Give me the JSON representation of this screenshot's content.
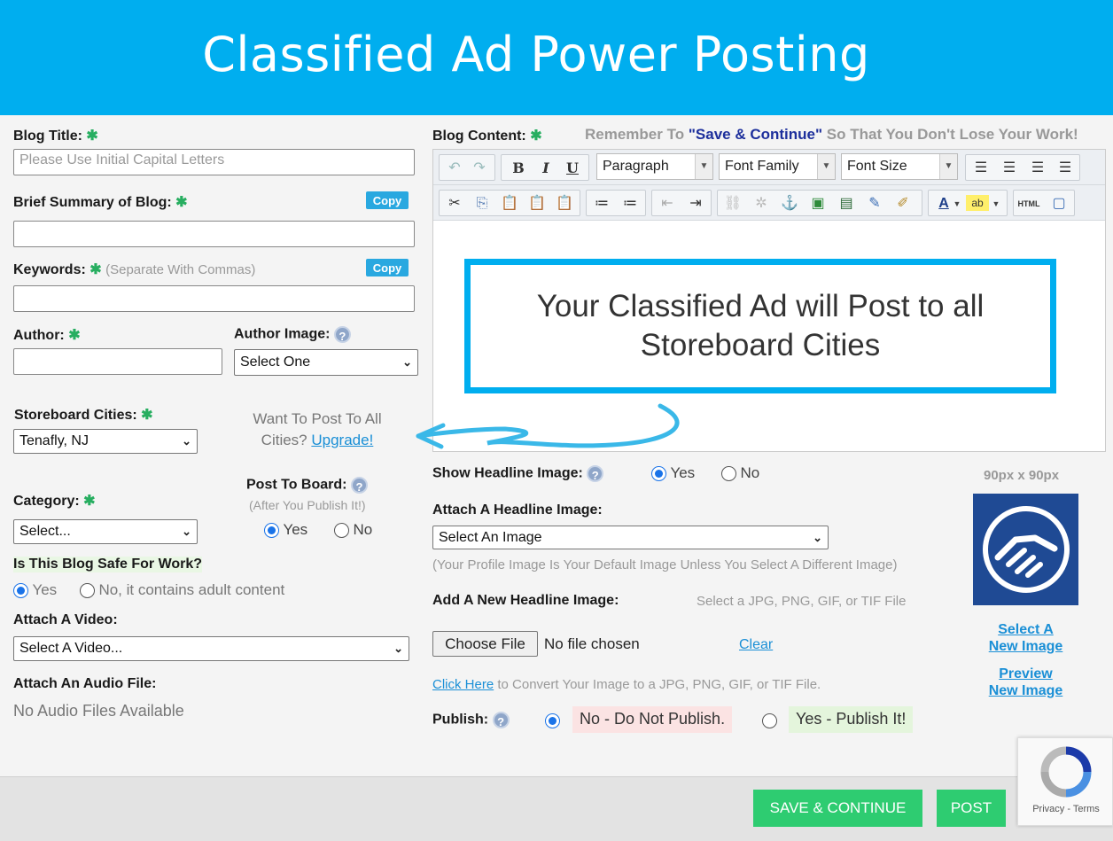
{
  "banner": {
    "title": "Classified Ad Power Posting"
  },
  "left": {
    "blog_title": {
      "label": "Blog Title:",
      "placeholder": "Please Use Initial Capital Letters"
    },
    "summary": {
      "label": "Brief Summary of Blog:",
      "copy": "Copy"
    },
    "keywords": {
      "label": "Keywords:",
      "hint": "(Separate With Commas)",
      "copy": "Copy"
    },
    "author": {
      "label": "Author:"
    },
    "author_image": {
      "label": "Author Image:",
      "value": "Select One"
    },
    "cities": {
      "label": "Storeboard Cities:",
      "value": "Tenafly, NJ",
      "promo": "Want To Post To All",
      "promo2": "Cities?",
      "upgrade": "Upgrade!"
    },
    "category": {
      "label": "Category:",
      "value": "Select..."
    },
    "post_board": {
      "label": "Post To Board:",
      "hint": "(After You Publish It!)",
      "yes": "Yes",
      "no": "No"
    },
    "safe": {
      "label": "Is This Blog Safe For Work?",
      "yes": "Yes",
      "no": "No, it contains adult content"
    },
    "video": {
      "label": "Attach A Video:",
      "value": "Select A Video..."
    },
    "audio": {
      "label": "Attach An Audio File:",
      "status": "No Audio Files Available"
    }
  },
  "editor": {
    "label": "Blog Content:",
    "reminder_pre": "Remember To",
    "reminder_em": "\"Save & Continue\"",
    "reminder_post": "So That You Don't Lose Your Work!",
    "format": "Paragraph",
    "font_family": "Font Family",
    "font_size": "Font Size",
    "html": "HTML"
  },
  "callout": {
    "text": "Your Classified Ad will Post to all Storeboard Cities"
  },
  "headline": {
    "show_label": "Show Headline Image:",
    "yes": "Yes",
    "no": "No",
    "attach_label": "Attach A Headline Image:",
    "attach_value": "Select An Image",
    "attach_hint": "(Your Profile Image Is Your Default Image Unless You Select A Different Image)",
    "add_label": "Add A New Headline Image:",
    "add_hint": "Select a JPG, PNG, GIF, or TIF File",
    "choose": "Choose File",
    "no_file": "No file chosen",
    "clear": "Clear",
    "convert_link": "Click Here",
    "convert_text": "to Convert Your Image to a JPG, PNG, GIF, or TIF File.",
    "size": "90px x 90px",
    "select_new_1": "Select A",
    "select_new_2": "New Image",
    "preview_1": "Preview",
    "preview_2": "New Image"
  },
  "publish": {
    "label": "Publish:",
    "no": "No - Do Not Publish.",
    "yes": "Yes - Publish It!"
  },
  "actions": {
    "save": "SAVE & CONTINUE",
    "post": "POST"
  },
  "recaptcha": {
    "text": "Privacy - Terms"
  },
  "colors": {
    "banner": "#00aeef",
    "green": "#2ecc71",
    "link": "#1a8fd6"
  }
}
